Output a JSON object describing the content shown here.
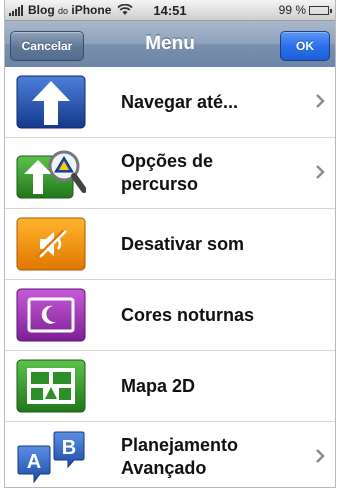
{
  "status_bar": {
    "carrier": "Blog",
    "carrier_small": "do",
    "carrier_suffix": "iPhone",
    "time": "14:51",
    "battery_text": "99 %",
    "battery_level": 0.99
  },
  "navbar": {
    "title": "Menu",
    "cancel_label": "Cancelar",
    "ok_label": "OK"
  },
  "menu": {
    "items": [
      {
        "label": "Navegar até...",
        "icon": "arrow-up-icon",
        "has_chevron": true
      },
      {
        "label": "Opções de\npercurso",
        "icon": "route-options-icon",
        "has_chevron": true
      },
      {
        "label": "Desativar som",
        "icon": "mute-icon",
        "has_chevron": false
      },
      {
        "label": "Cores noturnas",
        "icon": "night-colors-icon",
        "has_chevron": false
      },
      {
        "label": "Mapa 2D",
        "icon": "map-2d-icon",
        "has_chevron": false
      },
      {
        "label": "Planejamento\nAvançado",
        "icon": "advanced-planning-icon",
        "has_chevron": true
      }
    ]
  },
  "colors": {
    "navbar": "#7990ad",
    "ok_button": "#2a6ee9",
    "icon_blue": "#1f4aa6",
    "icon_green": "#2e8f28",
    "icon_orange": "#f08a00",
    "icon_purple": "#8e2fa3"
  }
}
